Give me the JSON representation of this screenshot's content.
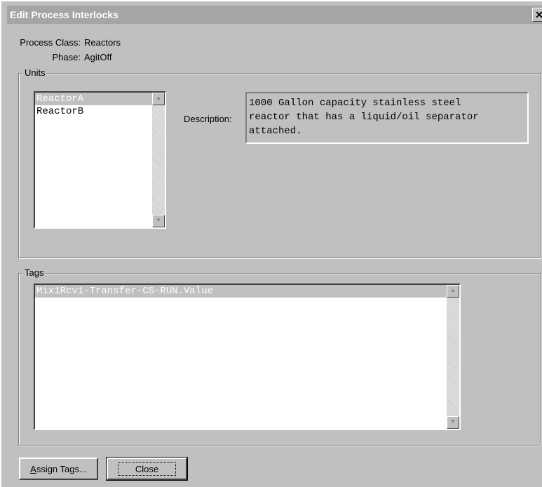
{
  "window": {
    "title": "Edit Process Interlocks",
    "close_glyph": "✕"
  },
  "info": {
    "process_class_label": "Process Class:",
    "process_class_value": "Reactors",
    "phase_label": "Phase:",
    "phase_value": "AgitOff"
  },
  "units": {
    "legend": "Units",
    "items": [
      "ReactorA",
      "ReactorB"
    ],
    "selected_index": 0,
    "description_label": "Description:",
    "description": "1000 Gallon capacity stainless steel\nreactor that has a liquid/oil separator\nattached."
  },
  "tags": {
    "legend": "Tags",
    "items": [
      "Mix1Rcv1-Transfer-CS-RUN.Value"
    ],
    "selected_index": 0
  },
  "buttons": {
    "assign_tags_first": "A",
    "assign_tags_rest": "ssign Tags...",
    "close_label": "Close"
  },
  "icons": {
    "scroll_up": "up-arrow-icon",
    "scroll_down": "down-arrow-icon"
  }
}
